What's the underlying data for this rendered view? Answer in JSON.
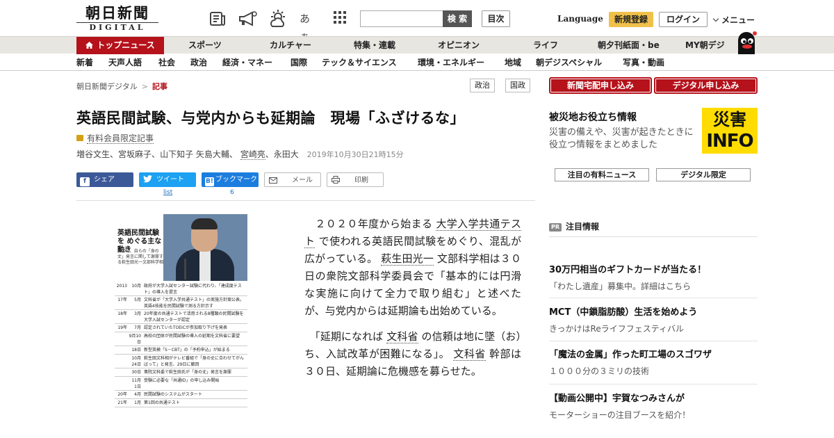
{
  "header": {
    "logo_jp": "朝日新聞",
    "logo_en": "DIGITAL",
    "search_placeholder": "",
    "search_button": "検 索",
    "toc_button": "目次",
    "font_size_label": "あぁ",
    "language": "Language",
    "signup": "新規登録",
    "login": "ログイン",
    "menu": "メニュー"
  },
  "nav_primary": [
    {
      "label": "トップニュース",
      "active": true
    },
    {
      "label": "スポーツ"
    },
    {
      "label": "カルチャー"
    },
    {
      "label": "特集・連載"
    },
    {
      "label": "オピニオン"
    },
    {
      "label": "ライフ"
    },
    {
      "label": "朝夕刊紙面・be"
    },
    {
      "label": "MY朝デジ"
    }
  ],
  "nav_secondary": [
    "新着",
    "天声人語",
    "社会",
    "政治",
    "経済・マネー",
    "国際",
    "テック＆サイエンス",
    "環境・エネルギー",
    "地域",
    "朝デジスペシャル",
    "写真・動画"
  ],
  "breadcrumb": {
    "home": "朝日新聞デジタル",
    "sep": ">",
    "current": "記事"
  },
  "tags": [
    "政治",
    "国政"
  ],
  "article": {
    "title": "英語民間試験、与党内からも延期論　現場「ふざけるな」",
    "members_only": "有料会員限定記事",
    "authors": [
      "増谷文生",
      "宮坂麻子",
      "山下知子",
      "矢島大輔",
      "宮崎亮",
      "永田大"
    ],
    "author_sep_1": "、",
    "date": "2019年10月30日21時15分",
    "share": {
      "facebook": "シェア",
      "twitter": "ツイート",
      "twitter_count": "list",
      "hatena": "ブックマーク",
      "hatena_count": "6",
      "mail": "メール",
      "print": "印刷"
    },
    "p1_a": "２０２０年度から始まる",
    "p1_link1": "大学入学共通テスト",
    "p1_b": "で使われる英語民間試験をめぐり、混乱が広がっている。",
    "p1_link2": "萩生田光一",
    "p1_c": "文部科学相は３０日の衆院文部科学委員会で「基本的には円滑な実施に向けて全力で取り組む」と述べたが、与党内からは延期論も出始めている。",
    "p2_a": "「延期になれば",
    "p2_link1": "文科省",
    "p2_b": "の信頼は地に墜（お）ち、入試改革が困難になる」。",
    "p2_link2": "文科省",
    "p2_c": "幹部は３０日、延期論に危機感を募らせた。"
  },
  "figure": {
    "title": "英語民間試験を めぐる主な動き",
    "subtitle": "国会で、自らの「身の丈」発言に関して謝罪する萩生田光一文部科学相",
    "timeline": [
      {
        "year": "2013",
        "md": "10月",
        "event": "政府が大学入試センター試験に代わり、「達成度テスト」の導入を提言"
      },
      {
        "year": "17年",
        "md": "5月",
        "event": "文科省が「大学入学共通テスト」の実施方針案公表。英語4技能を民間試験で測る方針示す"
      },
      {
        "year": "18年",
        "md": "3月",
        "event": "20年度の共通テストで活用される8種類の民間試験を大学入試センターが認定"
      },
      {
        "year": "19年",
        "md": "7月",
        "event": "認定されていたTOEICが参加取り下げを発表"
      },
      {
        "year": "",
        "md": "9月10日",
        "event": "高校の団体が民間試験の導入の延期を文科省に要望"
      },
      {
        "year": "",
        "md": "18日",
        "event": "新型英検「S－CBT」の「予約申込」が始まる"
      },
      {
        "year": "",
        "md": "10月24日",
        "event": "萩生田文科相がテレビ番組で「身の丈に合わせてがんばって」と発言、29日に撤回"
      },
      {
        "year": "",
        "md": "30日",
        "event": "衆院文科委で萩生田氏が「身の丈」発言を謝罪"
      },
      {
        "year": "",
        "md": "11月 1日",
        "event": "受験に必要な「共通ID」の申し込み開始"
      },
      {
        "year": "20年",
        "md": "4月",
        "event": "民間試験のシステムがスタート"
      },
      {
        "year": "21年",
        "md": "1月",
        "event": "第1回の共通テスト"
      }
    ]
  },
  "sidebar": {
    "btn_home_delivery": "新聞宅配申し込み",
    "btn_digital": "デジタル申し込み",
    "disaster_title": "被災地お役立ち情報",
    "disaster_text": "災害の備えや、災害が起きたときに役立つ情報をまとめました",
    "info_line1": "災害",
    "info_line2": "INFO",
    "btn_paid_news": "注目の有料ニュース",
    "btn_digital_only": "デジタル限定",
    "pr_badge": "PR",
    "pr_label": "注目情報",
    "ads": [
      {
        "head": "30万円相当のギフトカードが当たる！",
        "sub": "「わたし遺産」募集中。詳細はこちら"
      },
      {
        "head": "MCT（中鎖脂肪酸）生活を始めよう",
        "sub": "きっかけはReライフフェスティバル"
      },
      {
        "head": "「魔法の金属」作った町工場のスゴワザ",
        "sub": "１０００分の３ミリの技術"
      },
      {
        "head": "【動画公開中】宇賀なつみさんが",
        "sub": "モーターショーの注目ブースを紹介！"
      }
    ]
  },
  "colors": {
    "brand_red": "#b5121b",
    "signup_yellow": "#f0c14a",
    "facebook": "#3b5998",
    "twitter": "#1da1f2",
    "hatena": "#1b7dde",
    "info_yellow": "#ffdc00"
  }
}
